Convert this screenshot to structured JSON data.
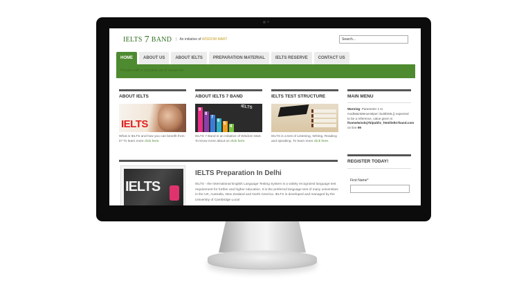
{
  "site": {
    "logo_text": "IELTS",
    "logo_number": "7",
    "logo_suffix": "BAND",
    "tagline_sep": "|",
    "tagline_prefix": "An initiative of",
    "tagline_brand": "WISDOM MART",
    "search_value": "Search..."
  },
  "nav": {
    "items": [
      {
        "label": "HOME",
        "active": true
      },
      {
        "label": "ABOUT US"
      },
      {
        "label": "ABOUT IELTS"
      },
      {
        "label": "PREPARATION MATERIAL"
      },
      {
        "label": "IELTS RESERVE"
      },
      {
        "label": "CONTACT US"
      }
    ]
  },
  "banner": {
    "text": "Prepare with a complete set of resources"
  },
  "columns": [
    {
      "title": "ABOUT IELTS",
      "image_text": "IELTS",
      "text": "What is IELTS and how you can benefit from it? To learn more",
      "link": "click here."
    },
    {
      "title": "ABOUT IELTS 7 BAND",
      "image_numbers": [
        "9",
        "8",
        "7",
        "6",
        "5",
        "4"
      ],
      "image_text": "IELTS",
      "text": "IELTS 7 Band is an initiative of Wisdom Mart. To know more about us",
      "link": "click here."
    },
    {
      "title": "IELTS TEST STRUCTURE",
      "text": "IELTS is a test of Listening, Writing, Reading and speaking. To learn more",
      "link": "click here."
    }
  ],
  "sidebar": {
    "main_menu_title": "MAIN MENU",
    "warning_label": "Warning",
    "warning_text": ": Parameter 1 to modMainMenuHelper::buildXML() expected to be a reference, value given in",
    "warning_path": "/home/wisdoj7b/public_html/ielts7band.com",
    "warning_line_prefix": "on line",
    "warning_line": "99",
    "register_title": "REGISTER TODAY!",
    "first_name_label": "First Name*"
  },
  "article": {
    "title": "IELTS Preparation In Delhi",
    "image_text": "IELTS",
    "body": "IELTS - the International English Language Testing System is a widely recognized language test requirement for further and higher education. It is the preferred language test of many universities in the UK, Australia, New Zealand and North America. IELTS is developed and managed by the University of Cambridge Local"
  },
  "colors": {
    "brand_green": "#4e8a2f",
    "tagline_brand": "#c8a021",
    "bezel": "#0c0c0c"
  }
}
